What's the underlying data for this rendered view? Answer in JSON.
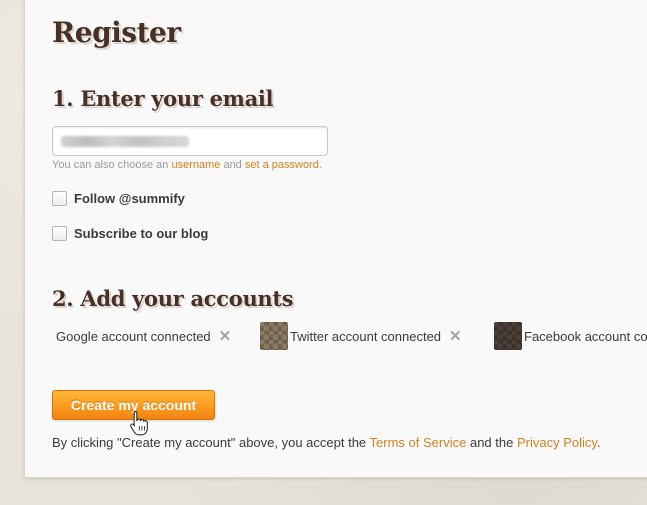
{
  "page": {
    "title": "Register"
  },
  "step1": {
    "heading": "1. Enter your email",
    "email_value": "••••••@•••••.•••",
    "hint_prefix": "You can also choose an ",
    "hint_username_link": "username",
    "hint_middle": " and ",
    "hint_password_link": "set a password",
    "hint_suffix": ".",
    "options": [
      {
        "label": "Follow @summify",
        "checked": false
      },
      {
        "label": "Subscribe to our blog",
        "checked": false
      }
    ]
  },
  "step2": {
    "heading": "2. Add your accounts",
    "accounts": [
      {
        "label": "Google account connected",
        "icon": "close-icon"
      },
      {
        "label": "Twitter account connected",
        "icon": "close-icon"
      },
      {
        "label": "Facebook account co"
      }
    ]
  },
  "actions": {
    "create_label": "Create my account"
  },
  "terms": {
    "prefix": "By clicking \"Create my account\" above, you accept the ",
    "tos_link": "Terms of Service",
    "middle": " and the ",
    "privacy_link": "Privacy Policy",
    "suffix": "."
  },
  "colors": {
    "accent": "#fb9a1e",
    "link": "#d3801f",
    "heading": "#4a2f25"
  }
}
